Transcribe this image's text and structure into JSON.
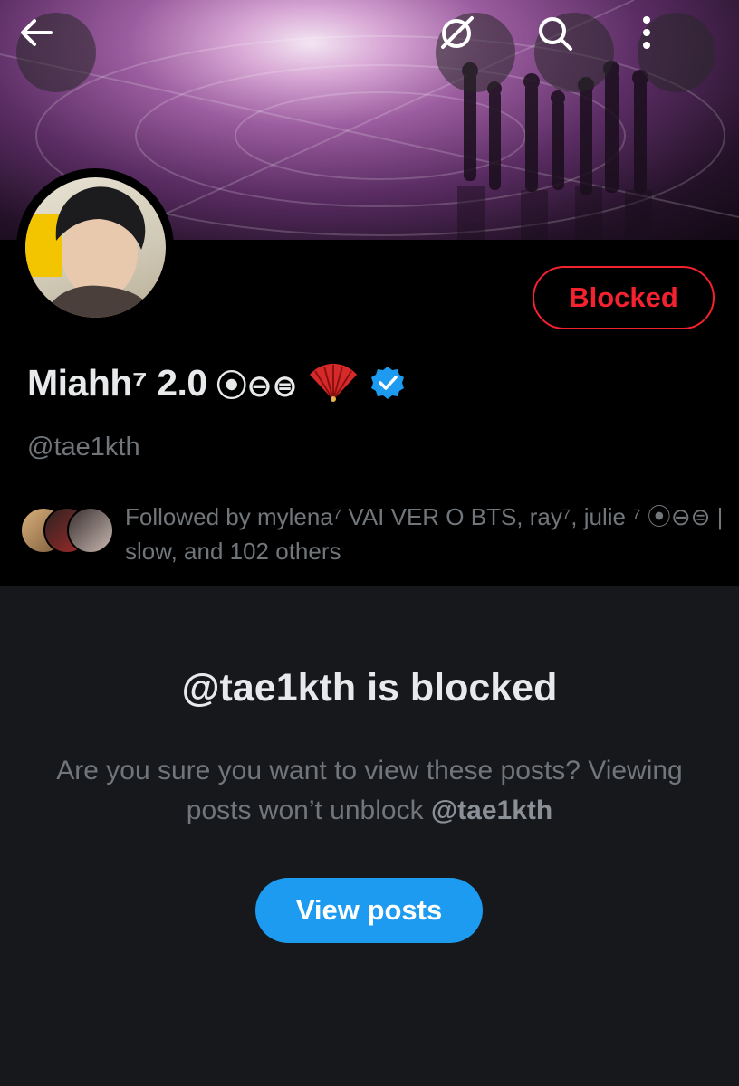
{
  "nav": {
    "back_icon": "arrow-left-icon",
    "grok_icon": "grok-icon",
    "search_icon": "search-icon",
    "more_icon": "more-vertical-icon"
  },
  "profile": {
    "display_name": "Miahh⁷ 2.0",
    "name_symbols": "⦿⊖⊜",
    "handle": "@tae1kth",
    "blocked_label": "Blocked",
    "followed_by_text": "Followed by mylena⁷ VAI VER O BTS, ray⁷, julie ⁷ ⦿⊖⊜ | slow, and 102 others",
    "verified_icon": "verified-badge-icon",
    "fan_icon": "fan-emoji-icon"
  },
  "blocked_panel": {
    "title": "@tae1kth is blocked",
    "description_prefix": "Are you sure you want to view these posts? Viewing posts won’t unblock ",
    "description_handle": "@tae1kth",
    "view_button": "View posts"
  },
  "colors": {
    "danger": "#f4212e",
    "accent": "#1d9bf0",
    "muted_text": "#71767b",
    "panel_bg": "#16181c"
  }
}
